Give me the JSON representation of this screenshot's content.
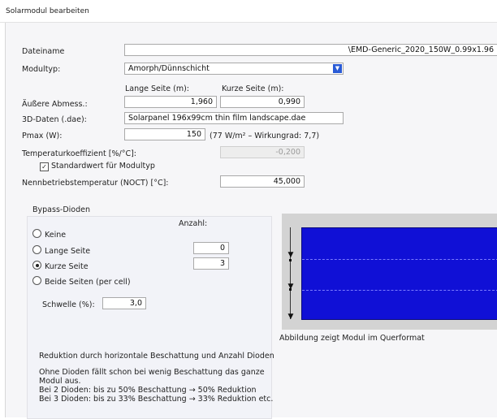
{
  "window": {
    "title": "Solarmodul bearbeiten"
  },
  "form": {
    "dateiname_label": "Dateiname",
    "dateiname_value": "\\EMD-Generic_2020_150W_0.99x1.96",
    "modultyp_label": "Modultyp:",
    "modultyp_value": "Amorph/Dünnschicht",
    "lange_seite_label": "Lange Seite (m):",
    "kurze_seite_label": "Kurze Seite (m):",
    "abmess_label": "Äußere Abmess.:",
    "lange_seite_value": "1,960",
    "kurze_seite_value": "0,990",
    "dae_label": "3D-Daten (.dae):",
    "dae_value": "Solarpanel 196x99cm thin film landscape.dae",
    "pmax_label": "Pmax (W):",
    "pmax_value": "150",
    "pmax_info": "(77 W/m²  –  Wirkungrad: 7,7)",
    "temp_label": "Temperaturkoeffizient [%/°C]:",
    "temp_value": "-0,200",
    "standardwert_label": "Standardwert für Modultyp",
    "standardwert_checked": true,
    "noct_label": "Nennbetriebstemperatur (NOCT) [°C]:",
    "noct_value": "45,000"
  },
  "bypass": {
    "group_title": "Bypass-Dioden",
    "anzahl_label": "Anzahl:",
    "options": [
      {
        "label": "Keine",
        "selected": false
      },
      {
        "label": "Lange Seite",
        "selected": false
      },
      {
        "label": "Kurze Seite",
        "selected": true
      },
      {
        "label": "Beide Seiten (per cell)",
        "selected": false
      }
    ],
    "anzahl_lange": "0",
    "anzahl_kurze": "3",
    "schwelle_label": "Schwelle (%):",
    "schwelle_value": "3,0",
    "info_title": "Reduktion durch horizontale Beschattung und Anzahl Dioden",
    "info_lines": [
      "Ohne Dioden fällt schon bei wenig Beschattung das ganze",
      "Modul aus.",
      "Bei 2 Dioden: bis zu 50% Beschattung → 50% Reduktion",
      "Bei 3 Dioden: bis zu 33% Beschattung → 33% Reduktion etc."
    ]
  },
  "preview": {
    "caption": "Abbildung zeigt Modul im Querformat",
    "module_color": "#1010d6",
    "background_color": "#d3d3d3"
  }
}
